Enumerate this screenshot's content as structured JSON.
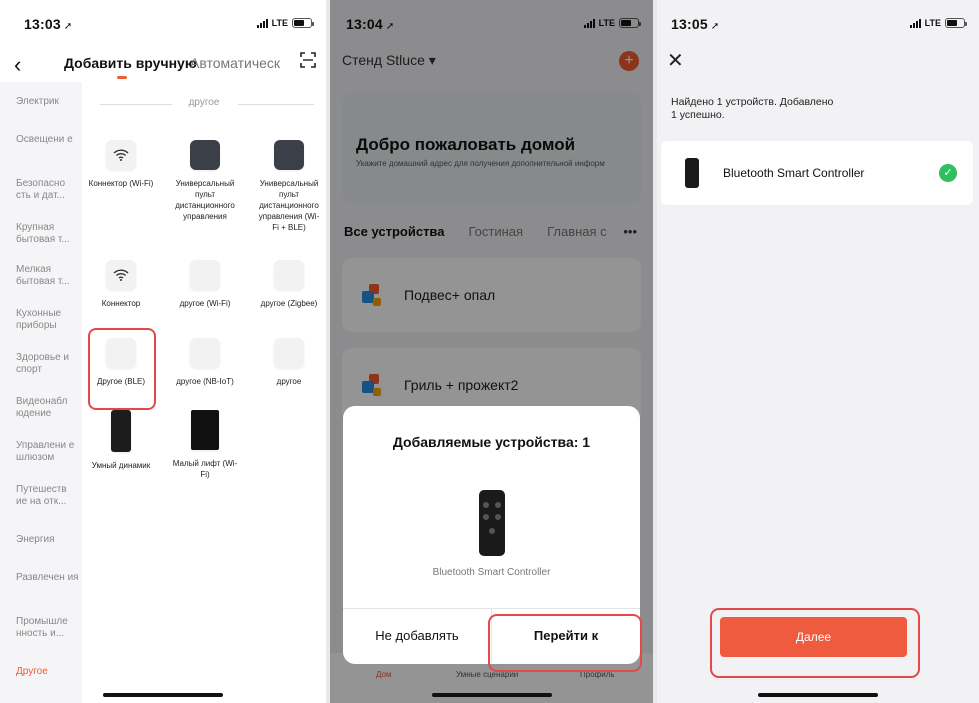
{
  "screen1": {
    "status": {
      "time": "13:03",
      "network": "LTE"
    },
    "tabs": {
      "active": "Добавить вручную",
      "inactive": "Автоматическ"
    },
    "categories": [
      "Электрик",
      "Освещени е",
      "Безопасно сть и дат...",
      "Крупная бытовая т...",
      "Мелкая бытовая т...",
      "Кухонные приборы",
      "Здоровье и спорт",
      "Видеонабл юдение",
      "Управлени е шлюзом",
      "Путешеств ие на отк...",
      "Энергия",
      "Развлечен ия",
      "Промышле нность и...",
      "Другое"
    ],
    "section_title": "другое",
    "devices": [
      {
        "label": "Коннектор (Wi-Fi)"
      },
      {
        "label": "Универсальный пульт дистанционного управления"
      },
      {
        "label": "Универсальный пульт дистанционного управления (Wi-Fi + BLE)"
      },
      {
        "label": "Коннектор"
      },
      {
        "label": "другое (Wi-Fi)"
      },
      {
        "label": "другое (Zigbee)"
      },
      {
        "label": "Другое (BLE)"
      },
      {
        "label": "другое (NB-IoT)"
      },
      {
        "label": "другое"
      },
      {
        "label": "Умный динамик"
      },
      {
        "label": "Малый лифт (Wi-Fi)"
      }
    ]
  },
  "screen2": {
    "status": {
      "time": "13:04",
      "network": "LTE"
    },
    "home_title": "Стенд Stluce ▾",
    "add_icon": "+",
    "welcome_title": "Добро пожаловать домой",
    "welcome_sub": "Укажите домашний адрес для получения дополнительной информ",
    "rooms": {
      "active": "Все устройства",
      "r1": "Гостиная",
      "r2": "Главная с",
      "more": "•••"
    },
    "cards": [
      {
        "label": "Подвес+ опал"
      },
      {
        "label": "Гриль + прожект2"
      }
    ],
    "tabbar": {
      "home": "Дом",
      "scenes": "Умные сценарии",
      "profile": "Профиль"
    },
    "modal": {
      "title": "Добавляемые устройства: 1",
      "device_name": "Bluetooth Smart Controller",
      "cancel": "Не добавлять",
      "confirm": "Перейти к добавлению"
    }
  },
  "screen3": {
    "status": {
      "time": "13:05",
      "network": "LTE"
    },
    "close_icon": "✕",
    "found_line1": "Найдено 1 устройств. Добавлено",
    "found_line2": "1 успешно.",
    "device_name": "Bluetooth Smart Controller",
    "check_icon": "✓",
    "next_button": "Далее"
  },
  "colors": {
    "accent": "#f25c30",
    "highlight": "#e24a4a",
    "success": "#2fbf5f"
  }
}
